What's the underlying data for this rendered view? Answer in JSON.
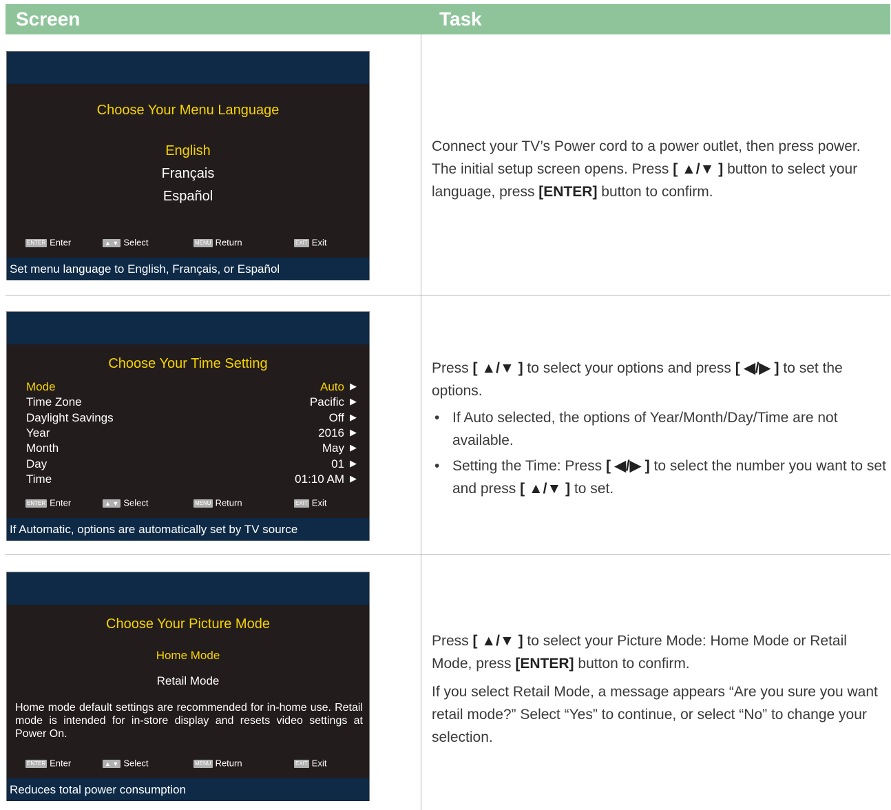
{
  "header": {
    "col_screen": "Screen",
    "col_task": "Task"
  },
  "keys": {
    "enter_badge": "ENTER",
    "enter": "Enter",
    "select_badge": "▲ ▼",
    "select": "Select",
    "menu_badge": "MENU",
    "return": "Return",
    "exit_badge": "EXIT",
    "exit": "Exit"
  },
  "screen1": {
    "title": "Choose Your Menu Language",
    "options": [
      "English",
      "Français",
      "Español"
    ],
    "selected": "English",
    "footer": "Set menu language to English, Français, or Español"
  },
  "task1": {
    "text_a": "Connect your TV’s Power cord to a power outlet, then press power. The initial setup screen opens. Press ",
    "btn1": "[ ▲/▼ ]",
    "text_b": " button to select your language, press ",
    "btn2": "[ENTER]",
    "text_c": " button to confirm."
  },
  "screen2": {
    "title": "Choose Your Time Setting",
    "rows": [
      {
        "label": "Mode",
        "value": "Auto",
        "selected": true
      },
      {
        "label": "Time Zone",
        "value": "Pacific"
      },
      {
        "label": "Daylight Savings",
        "value": "Off"
      },
      {
        "label": "Year",
        "value": "2016"
      },
      {
        "label": "Month",
        "value": "May"
      },
      {
        "label": "Day",
        "value": "01"
      },
      {
        "label": "Time",
        "value": "01:10 AM"
      }
    ],
    "arrow_icon": "▶",
    "footer": "If Automatic, options are automatically set by TV source"
  },
  "task2": {
    "p_a": "Press ",
    "btn_ud": "[ ▲/▼ ]",
    "p_b": " to select your options and press ",
    "btn_lr": "[ ◀/▶ ]",
    "p_c": " to set the options.",
    "bullet1": "If Auto selected, the options of Year/Month/Day/Time are not available.",
    "bullet2_a": "Setting the Time: Press ",
    "bullet2_b": " to select the number you want to set and press ",
    "bullet2_c": " to set."
  },
  "screen3": {
    "title": "Choose Your Picture Mode",
    "options": [
      "Home Mode",
      "Retail Mode"
    ],
    "selected": "Home Mode",
    "description": "Home mode default settings are recommended for in-home use. Retail mode is intended for in-store display and resets video settings at Power On.",
    "footer": "Reduces total power consumption"
  },
  "task3": {
    "p1_a": "Press ",
    "btn_ud": "[ ▲/▼ ]",
    "p1_b": " to select your Picture Mode: Home Mode or Retail Mode, press ",
    "btn_enter": "[ENTER]",
    "p1_c": " button to confirm.",
    "p2": "If you select Retail Mode, a message appears “Are you sure you want retail mode?” Select “Yes” to continue, or select “No” to change your selection."
  }
}
